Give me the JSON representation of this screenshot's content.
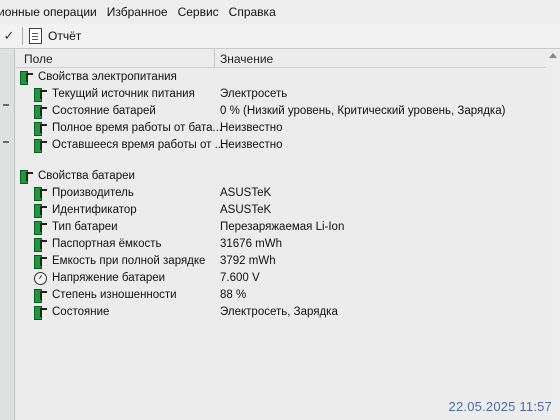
{
  "menubar": {
    "items": [
      "ионные операции",
      "Избранное",
      "Сервис",
      "Справка"
    ]
  },
  "toolbar": {
    "check_icon": "checkmark-icon",
    "report_label": "Отчёт"
  },
  "table": {
    "columns": [
      "Поле",
      "Значение"
    ],
    "sections": [
      {
        "title": "Свойства электропитания",
        "rows": [
          {
            "field": "Текущий источник питания",
            "value": "Электросеть",
            "icon": "battery-plug-icon"
          },
          {
            "field": "Состояние батарей",
            "value": "0 % (Низкий уровень, Критический уровень, Зарядка)",
            "icon": "battery-plug-icon"
          },
          {
            "field": "Полное время работы от бата...",
            "value": "Неизвестно",
            "icon": "battery-plug-icon"
          },
          {
            "field": "Оставшееся время работы от ...",
            "value": "Неизвестно",
            "icon": "battery-plug-icon"
          }
        ]
      },
      {
        "title": "Свойства батареи",
        "rows": [
          {
            "field": "Производитель",
            "value": "ASUSTeK",
            "icon": "battery-plug-icon"
          },
          {
            "field": "Идентификатор",
            "value": "ASUSTeK",
            "icon": "battery-plug-icon"
          },
          {
            "field": "Тип батареи",
            "value": "Перезаряжаемая Li-Ion",
            "icon": "battery-plug-icon"
          },
          {
            "field": "Паспортная ёмкость",
            "value": "31676 mWh",
            "icon": "battery-plug-icon"
          },
          {
            "field": "Емкость при полной зарядке",
            "value": "3792 mWh",
            "icon": "battery-plug-icon"
          },
          {
            "field": "Напряжение батареи",
            "value": "7.600 V",
            "icon": "gauge-icon"
          },
          {
            "field": "Степень изношенности",
            "value": "88 %",
            "icon": "battery-plug-icon"
          },
          {
            "field": "Состояние",
            "value": "Электросеть, Зарядка",
            "icon": "battery-plug-icon"
          }
        ]
      }
    ]
  },
  "timestamp": "22.05.2025 11:57",
  "colors": {
    "battery_green": "#1a9a3a",
    "timestamp_blue": "#4a6fa8"
  }
}
